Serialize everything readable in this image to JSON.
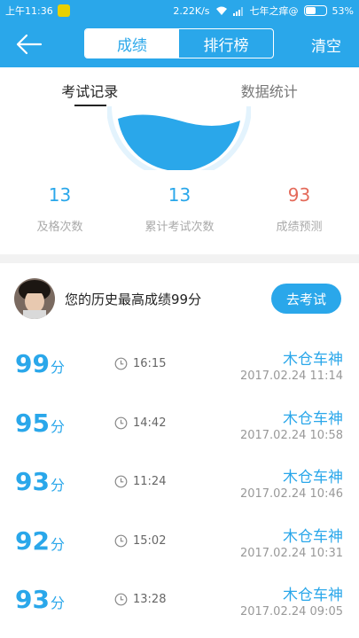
{
  "status_bar": {
    "time": "上午11:36",
    "speed": "2.22K/s",
    "carrier": "七年之痒@",
    "battery": "53%",
    "battery_level": 0.53
  },
  "nav": {
    "back_icon": "arrow-left-icon",
    "tabs": [
      {
        "label": "成绩",
        "active": true
      },
      {
        "label": "排行榜",
        "active": false
      }
    ],
    "clear_label": "清空"
  },
  "sub_tabs": [
    {
      "label": "考试记录",
      "active": true
    },
    {
      "label": "数据统计",
      "active": false
    }
  ],
  "stats": [
    {
      "value": "13",
      "label": "及格次数"
    },
    {
      "value": "13",
      "label": "累计考试次数"
    },
    {
      "value": "93",
      "label": "成绩预测"
    }
  ],
  "best": {
    "text": "您的历史最高成绩99分",
    "button": "去考试"
  },
  "records": [
    {
      "score": "99",
      "unit": "分",
      "duration": "16:15",
      "name": "木仓车神",
      "date": "2017.02.24  11:14"
    },
    {
      "score": "95",
      "unit": "分",
      "duration": "14:42",
      "name": "木仓车神",
      "date": "2017.02.24  10:58"
    },
    {
      "score": "93",
      "unit": "分",
      "duration": "11:24",
      "name": "木仓车神",
      "date": "2017.02.24  10:46"
    },
    {
      "score": "92",
      "unit": "分",
      "duration": "15:02",
      "name": "木仓车神",
      "date": "2017.02.24  10:31"
    },
    {
      "score": "93",
      "unit": "分",
      "duration": "13:28",
      "name": "木仓车神",
      "date": "2017.02.24  09:05"
    }
  ],
  "colors": {
    "primary": "#2aa7ea",
    "prediction": "#e46a5a"
  }
}
